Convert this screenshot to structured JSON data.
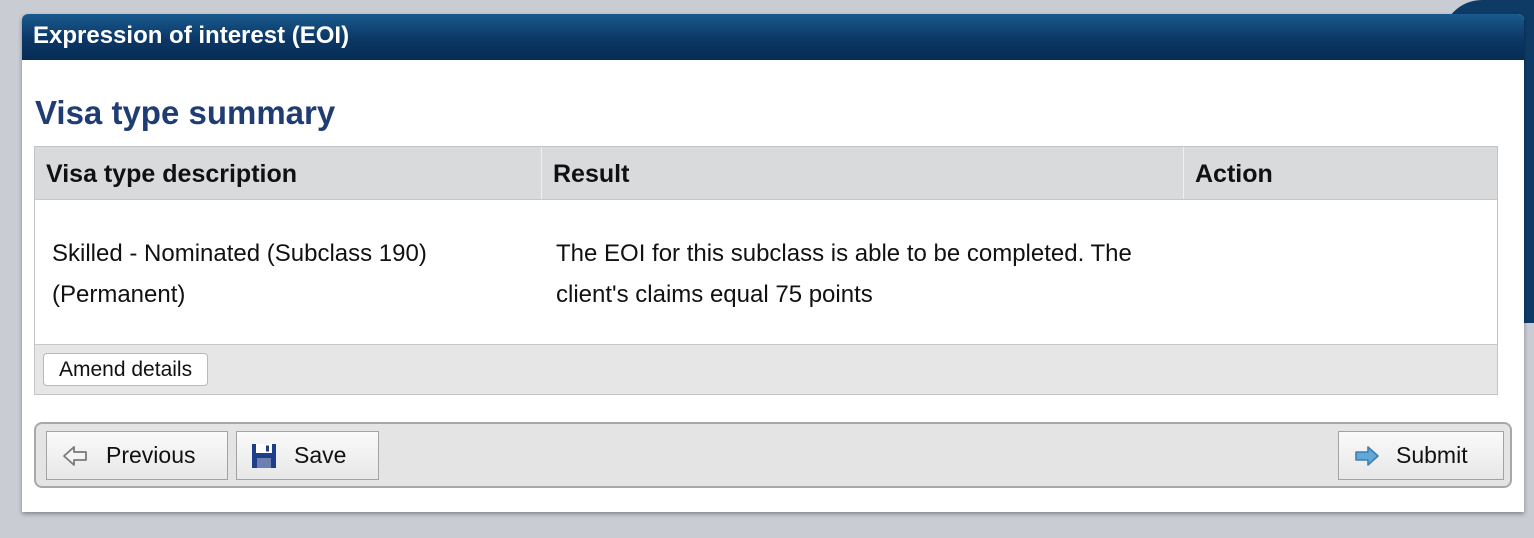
{
  "window": {
    "title": "Expression of interest (EOI)"
  },
  "section": {
    "title": "Visa type summary"
  },
  "table": {
    "headers": [
      "Visa type description",
      "Result",
      "Action"
    ],
    "rows": [
      {
        "description_line1": "Skilled - Nominated (Subclass 190)",
        "description_line2": "(Permanent)",
        "result_line1": "The EOI for this subclass is able to be completed. The",
        "result_line2": "client's claims equal 75 points",
        "action": ""
      }
    ]
  },
  "buttons": {
    "amend": "Amend details",
    "previous": "Previous",
    "save": "Save",
    "submit": "Submit"
  },
  "icons": {
    "previous": "arrow-left-icon",
    "save": "floppy-disk-icon",
    "submit": "arrow-right-icon"
  },
  "colors": {
    "header_bg": "#0b3766",
    "title_text": "#1f3c73",
    "submit_arrow": "#5fa8d8"
  }
}
